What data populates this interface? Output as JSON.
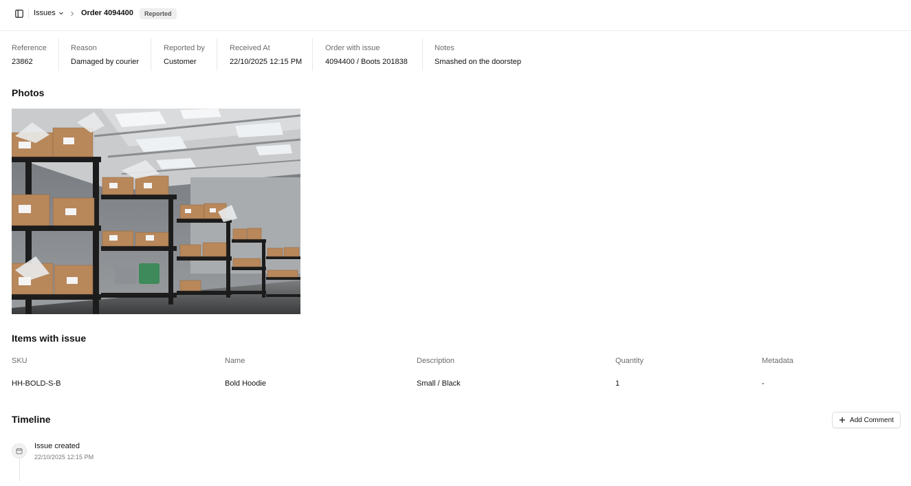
{
  "breadcrumb": {
    "issues_label": "Issues",
    "order_label": "Order 4094400",
    "status": "Reported"
  },
  "meta": [
    {
      "label": "Reference",
      "value": "23862"
    },
    {
      "label": "Reason",
      "value": "Damaged by courier"
    },
    {
      "label": "Reported by",
      "value": "Customer"
    },
    {
      "label": "Received At",
      "value": "22/10/2025 12:15 PM"
    },
    {
      "label": "Order with issue",
      "value": "4094400 / Boots 201838"
    },
    {
      "label": "Notes",
      "value": "Smashed on the doorstep"
    }
  ],
  "photos": {
    "title": "Photos"
  },
  "items": {
    "title": "Items with issue",
    "columns": [
      "SKU",
      "Name",
      "Description",
      "Quantity",
      "Metadata"
    ],
    "rows": [
      [
        "HH-BOLD-S-B",
        "Bold Hoodie",
        "Small / Black",
        "1",
        "-"
      ]
    ]
  },
  "timeline": {
    "title": "Timeline",
    "add_comment_label": "Add Comment",
    "events": [
      {
        "title": "Issue created",
        "time": "22/10/2025 12:15 PM",
        "icon": "calendar-icon"
      }
    ]
  }
}
